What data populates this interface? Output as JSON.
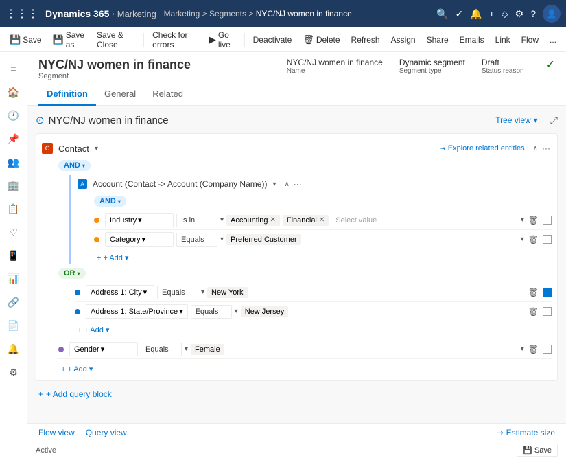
{
  "app": {
    "waffle": "⋮⋮⋮",
    "name": "Dynamics 365",
    "module": "Marketing",
    "breadcrumb": "Marketing > Segments > NYC/NJ women in finance",
    "nav_icons": [
      "🔍",
      "✓",
      "🔔",
      "+",
      "▽",
      "⚙",
      "?"
    ]
  },
  "command_bar": {
    "save": "Save",
    "save_as": "Save as",
    "save_close": "Save & Close",
    "check_errors": "Check for errors",
    "go_live": "Go live",
    "deactivate": "Deactivate",
    "delete": "Delete",
    "refresh": "Refresh",
    "assign": "Assign",
    "share": "Share",
    "emails": "Emails",
    "link": "Link",
    "flow": "Flow",
    "more": "..."
  },
  "page": {
    "title": "NYC/NJ women in finance",
    "subtitle": "Segment",
    "meta": {
      "name_label": "Name",
      "name_value": "NYC/NJ women in finance",
      "type_label": "Segment type",
      "type_value": "Dynamic segment",
      "status_label": "Status reason",
      "status_value": "Draft"
    }
  },
  "tabs": [
    "Definition",
    "General",
    "Related"
  ],
  "builder": {
    "title": "NYC/NJ women in finance",
    "tree_view": "Tree view",
    "entity": "Contact",
    "explore_label": "Explore related entities",
    "logic_and": "AND",
    "nested_entity": "Account (Contact -> Account (Company Name))",
    "nested_and": "AND",
    "conditions": [
      {
        "id": 1,
        "color": "orange",
        "field": "Industry",
        "operator": "Is in",
        "values": [
          "Accounting",
          "Financial"
        ],
        "placeholder": "Select value"
      },
      {
        "id": 2,
        "color": "orange",
        "field": "Category",
        "operator": "Equals",
        "values": [
          "Preferred Customer"
        ],
        "placeholder": ""
      }
    ],
    "add_label": "+ Add",
    "or_logic": "OR",
    "or_conditions": [
      {
        "id": 3,
        "color": "blue",
        "field": "Address 1: City",
        "operator": "Equals",
        "values": [
          "New York"
        ]
      },
      {
        "id": 4,
        "color": "blue",
        "field": "Address 1: State/Province",
        "operator": "Equals",
        "values": [
          "New Jersey"
        ]
      }
    ],
    "gender_condition": {
      "color": "purple",
      "field": "Gender",
      "operator": "Equals",
      "values": [
        "Female"
      ]
    },
    "add_query_block": "+ Add query block"
  },
  "bottom": {
    "flow_view": "Flow view",
    "query_view": "Query view",
    "estimate_size": "Estimate size"
  },
  "status_bar": {
    "status": "Active",
    "save": "Save"
  },
  "sidebar_icons": [
    "≡",
    "🏠",
    "👤",
    "📋",
    "♥",
    "📱",
    "📊",
    "🔗",
    "📄",
    "🔔",
    "📸",
    "⚙"
  ]
}
